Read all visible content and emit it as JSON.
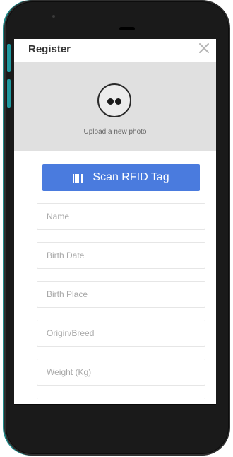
{
  "dialog": {
    "title": "Register"
  },
  "photo": {
    "upload_label": "Upload a new photo"
  },
  "scan_button": {
    "label": "Scan RFID Tag"
  },
  "fields": {
    "name": {
      "placeholder": "Name"
    },
    "birth_date": {
      "placeholder": "Birth Date"
    },
    "birth_place": {
      "placeholder": "Birth Place"
    },
    "origin_breed": {
      "placeholder": "Origin/Breed"
    },
    "weight": {
      "placeholder": "Weight (Kg)"
    },
    "next": {
      "placeholder": ""
    }
  },
  "colors": {
    "accent": "#4a7bde",
    "photo_background": "#e0e0e0",
    "phone_body": "#1a1a1a"
  },
  "icons": {
    "close": "close-icon",
    "avatar": "avatar-placeholder-icon",
    "scan": "barcode-icon"
  }
}
